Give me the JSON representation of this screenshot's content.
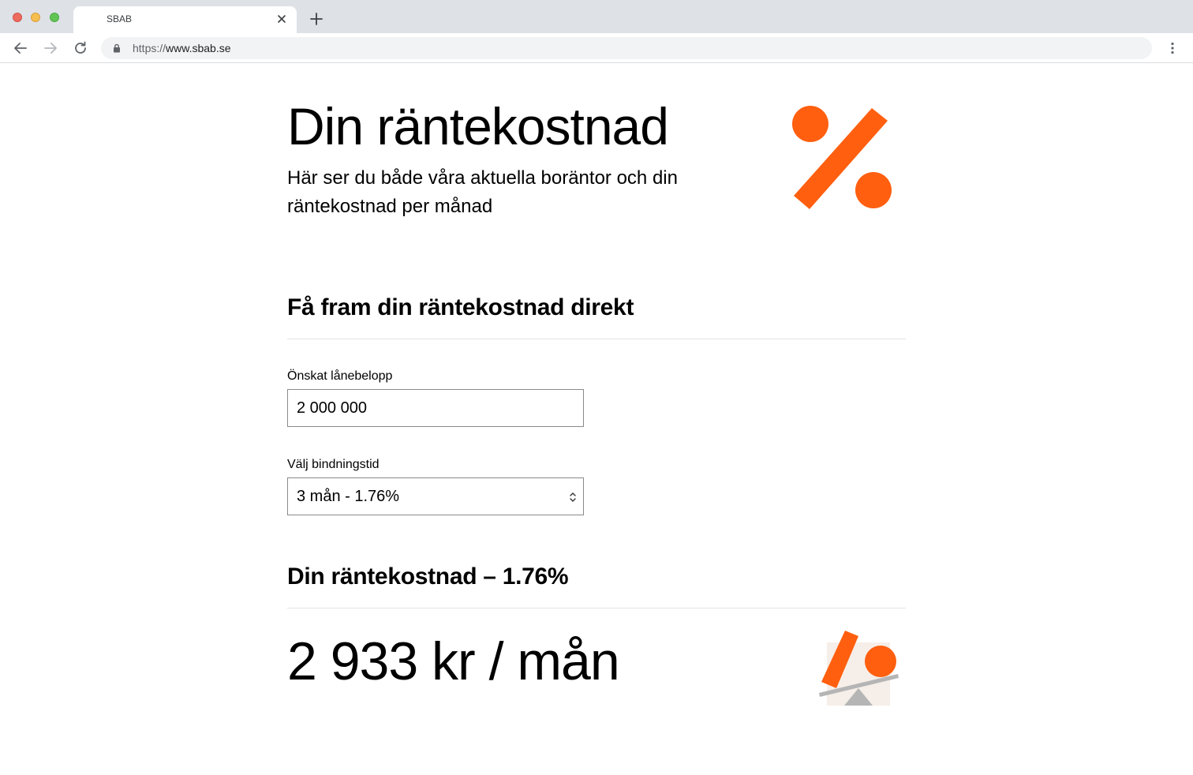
{
  "browser": {
    "tab_title": "SBAB",
    "url_scheme": "https://",
    "url_host": "www.sbab.se"
  },
  "hero": {
    "title": "Din räntekostnad",
    "subtitle": "Här ser du både våra aktuella boräntor och din räntekostnad per månad",
    "icon": "percent-icon"
  },
  "calculator": {
    "heading": "Få fram din räntekostnad direkt",
    "loan_amount_label": "Önskat lånebelopp",
    "loan_amount_value": "2 000 000",
    "binding_label": "Välj bindningstid",
    "binding_value": "3 mån - 1.76%"
  },
  "result": {
    "heading": "Din räntekostnad – 1.76%",
    "monthly_cost": "2 933 kr / mån",
    "icon": "seesaw-icon"
  },
  "colors": {
    "accent": "#ff5f0f",
    "chrome": "#dee1e6"
  }
}
